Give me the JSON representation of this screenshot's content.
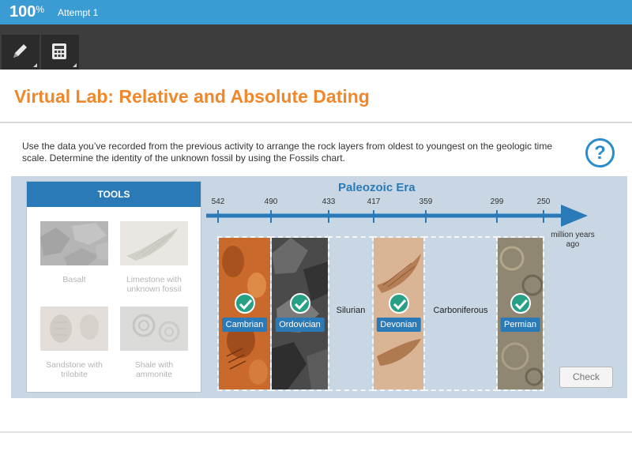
{
  "header": {
    "score": "100",
    "score_unit": "%",
    "attempt": "Attempt 1"
  },
  "toolbar": {
    "items": [
      {
        "name": "pencil",
        "icon": "pencil-icon"
      },
      {
        "name": "calculator",
        "icon": "calculator-icon"
      }
    ]
  },
  "page": {
    "title": "Virtual Lab: Relative and Absolute Dating",
    "instructions": "Use the data you’ve recorded from the previous activity to arrange the rock layers from oldest to youngest on the geologic time scale. Determine the identity of the unknown fossil by using the Fossils chart.",
    "help_label": "?"
  },
  "tools_panel": {
    "header": "TOOLS",
    "items": [
      {
        "label": "Basalt"
      },
      {
        "label": "Limestone with unknown fossil"
      },
      {
        "label": "Sandstone with trilobite"
      },
      {
        "label": "Shale with ammonite"
      }
    ]
  },
  "timeline": {
    "title": "Paleozoic Era",
    "unit": "million years ago",
    "ticks": [
      "542",
      "490",
      "433",
      "417",
      "359",
      "299",
      "250"
    ],
    "periods": [
      {
        "name": "Cambrian",
        "state": "placed-correct"
      },
      {
        "name": "Ordovician",
        "state": "placed-correct"
      },
      {
        "name": "Silurian",
        "state": "empty"
      },
      {
        "name": "Devonian",
        "state": "placed-correct"
      },
      {
        "name": "Carboniferous",
        "state": "empty"
      },
      {
        "name": "Permian",
        "state": "placed-correct"
      }
    ]
  },
  "check_button": "Check",
  "colors": {
    "topbar": "#3b9bd3",
    "toolbar": "#3d3d3d",
    "title": "#f0872a",
    "accent": "#2a7ab8",
    "check": "#27a086",
    "lab_bg": "#c8d7e3"
  }
}
